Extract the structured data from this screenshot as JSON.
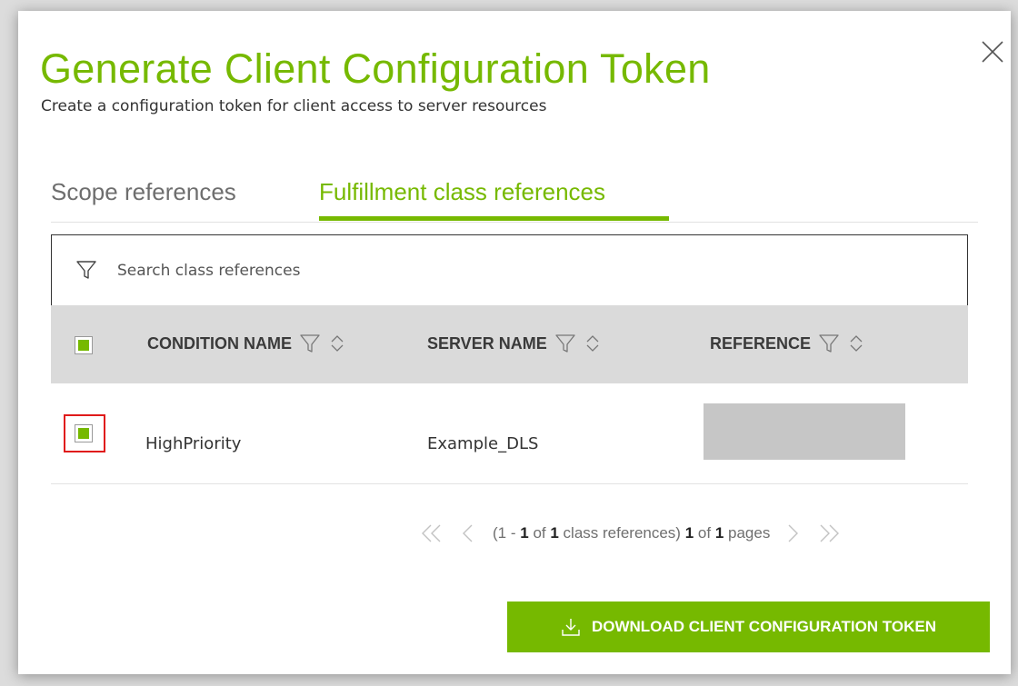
{
  "dialog": {
    "title": "Generate Client Configuration Token",
    "subtitle": "Create a configuration token for client access to server resources",
    "close_icon": "close-icon",
    "accent_color": "#76b900"
  },
  "tabs": [
    {
      "label": "Scope references",
      "active": false
    },
    {
      "label": "Fulfillment class references",
      "active": true
    }
  ],
  "search": {
    "placeholder": "Search class references",
    "value": "",
    "icon": "filter-icon"
  },
  "table": {
    "select_all_checked": true,
    "columns": [
      {
        "label": "CONDITION NAME",
        "filter_icon": "filter-icon",
        "sort_icon": "sort-icon"
      },
      {
        "label": "SERVER NAME",
        "filter_icon": "filter-icon",
        "sort_icon": "sort-icon"
      },
      {
        "label": "REFERENCE",
        "filter_icon": "filter-icon",
        "sort_icon": "sort-icon"
      }
    ],
    "rows": [
      {
        "checked": true,
        "condition_name": "HighPriority",
        "server_name": "Example_DLS",
        "reference": ""
      }
    ]
  },
  "pagination": {
    "range_start": "1",
    "range_sep": " - ",
    "range_end": "1",
    "of_word": " of ",
    "total": "1",
    "items_label": " class references)",
    "open_paren": "(",
    "current_page": "1",
    "page_of": " of ",
    "total_pages": "1",
    "pages_label": " pages"
  },
  "footer": {
    "download_label": "DOWNLOAD CLIENT CONFIGURATION TOKEN",
    "download_icon": "download-icon"
  }
}
